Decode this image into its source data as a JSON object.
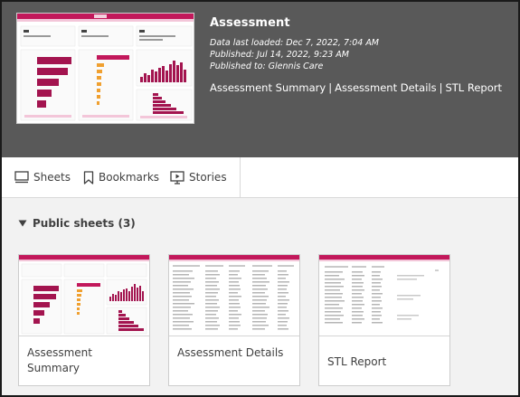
{
  "app": {
    "title": "Assessment",
    "data_loaded": "Data last loaded: Dec 7, 2022, 7:04 AM",
    "published": "Published: Jul 14, 2022, 9:23 AM",
    "published_to": "Published to: Glennis Care",
    "sheet_links": [
      "Assessment Summary",
      "Assessment Details",
      "STL Report"
    ],
    "link_separator": "|"
  },
  "tabs": [
    {
      "label": "Sheets",
      "icon": "sheets-icon"
    },
    {
      "label": "Bookmarks",
      "icon": "bookmark-icon"
    },
    {
      "label": "Stories",
      "icon": "stories-icon"
    }
  ],
  "public_sheets": {
    "heading": "Public sheets (3)",
    "cards": [
      {
        "label": "Assessment Summary"
      },
      {
        "label": "Assessment Details"
      },
      {
        "label": "STL Report"
      }
    ]
  },
  "colors": {
    "header_bg": "#595959",
    "accent": "#b5175e",
    "accent_light": "#e0a3c0",
    "orange": "#f0a030"
  }
}
